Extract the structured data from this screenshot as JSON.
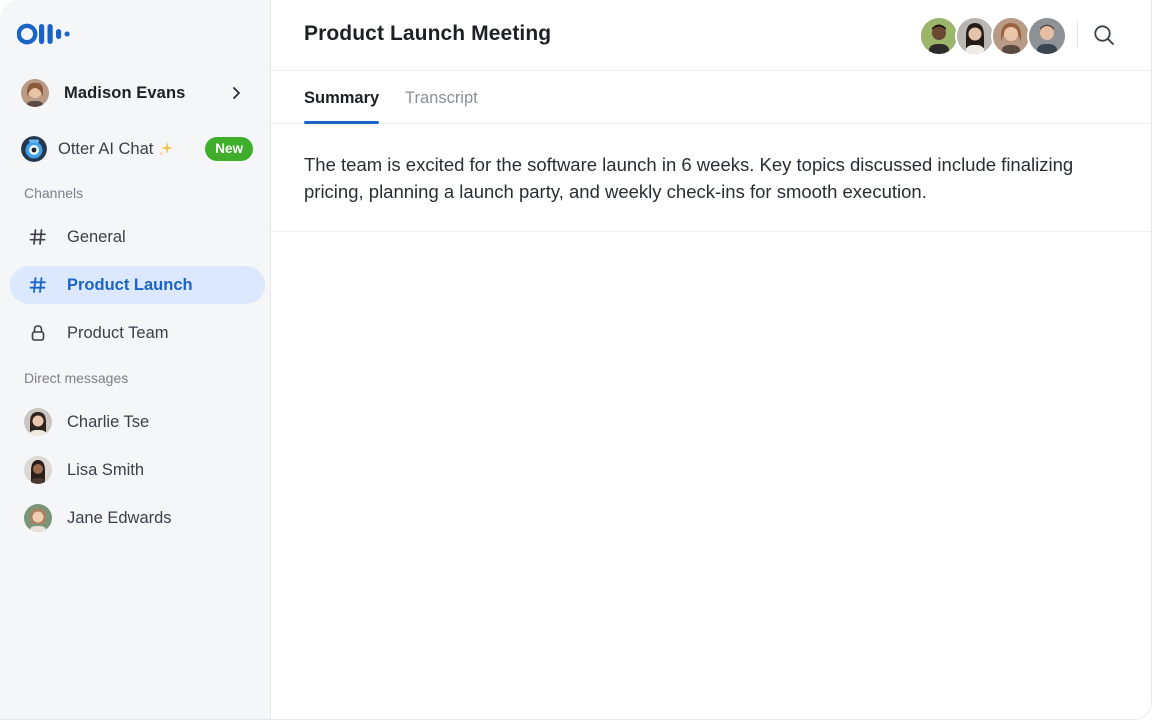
{
  "sidebar": {
    "user": {
      "name": "Madison Evans"
    },
    "otter_chat": {
      "label": "Otter AI Chat",
      "badge": "New"
    },
    "channels_label": "Channels",
    "channels": [
      {
        "label": "General",
        "icon": "hash-icon",
        "active": false
      },
      {
        "label": "Product Launch",
        "icon": "hash-icon",
        "active": true
      },
      {
        "label": "Product Team",
        "icon": "lock-icon",
        "active": false
      }
    ],
    "dm_label": "Direct messages",
    "direct_messages": [
      {
        "label": "Charlie Tse"
      },
      {
        "label": "Lisa Smith"
      },
      {
        "label": "Jane Edwards"
      }
    ]
  },
  "main": {
    "title": "Product Launch Meeting",
    "tabs": [
      {
        "label": "Summary",
        "active": true
      },
      {
        "label": "Transcript",
        "active": false
      }
    ],
    "summary": "The team is excited for the software launch in 6 weeks. Key topics discussed include finalizing pricing, planning a launch party, and weekly check-ins for smooth execution."
  },
  "colors": {
    "accent": "#1a64c8",
    "active_bg": "#dce8fd",
    "badge_green": "#3fae2a",
    "sidebar_bg": "#f5f6f7"
  }
}
